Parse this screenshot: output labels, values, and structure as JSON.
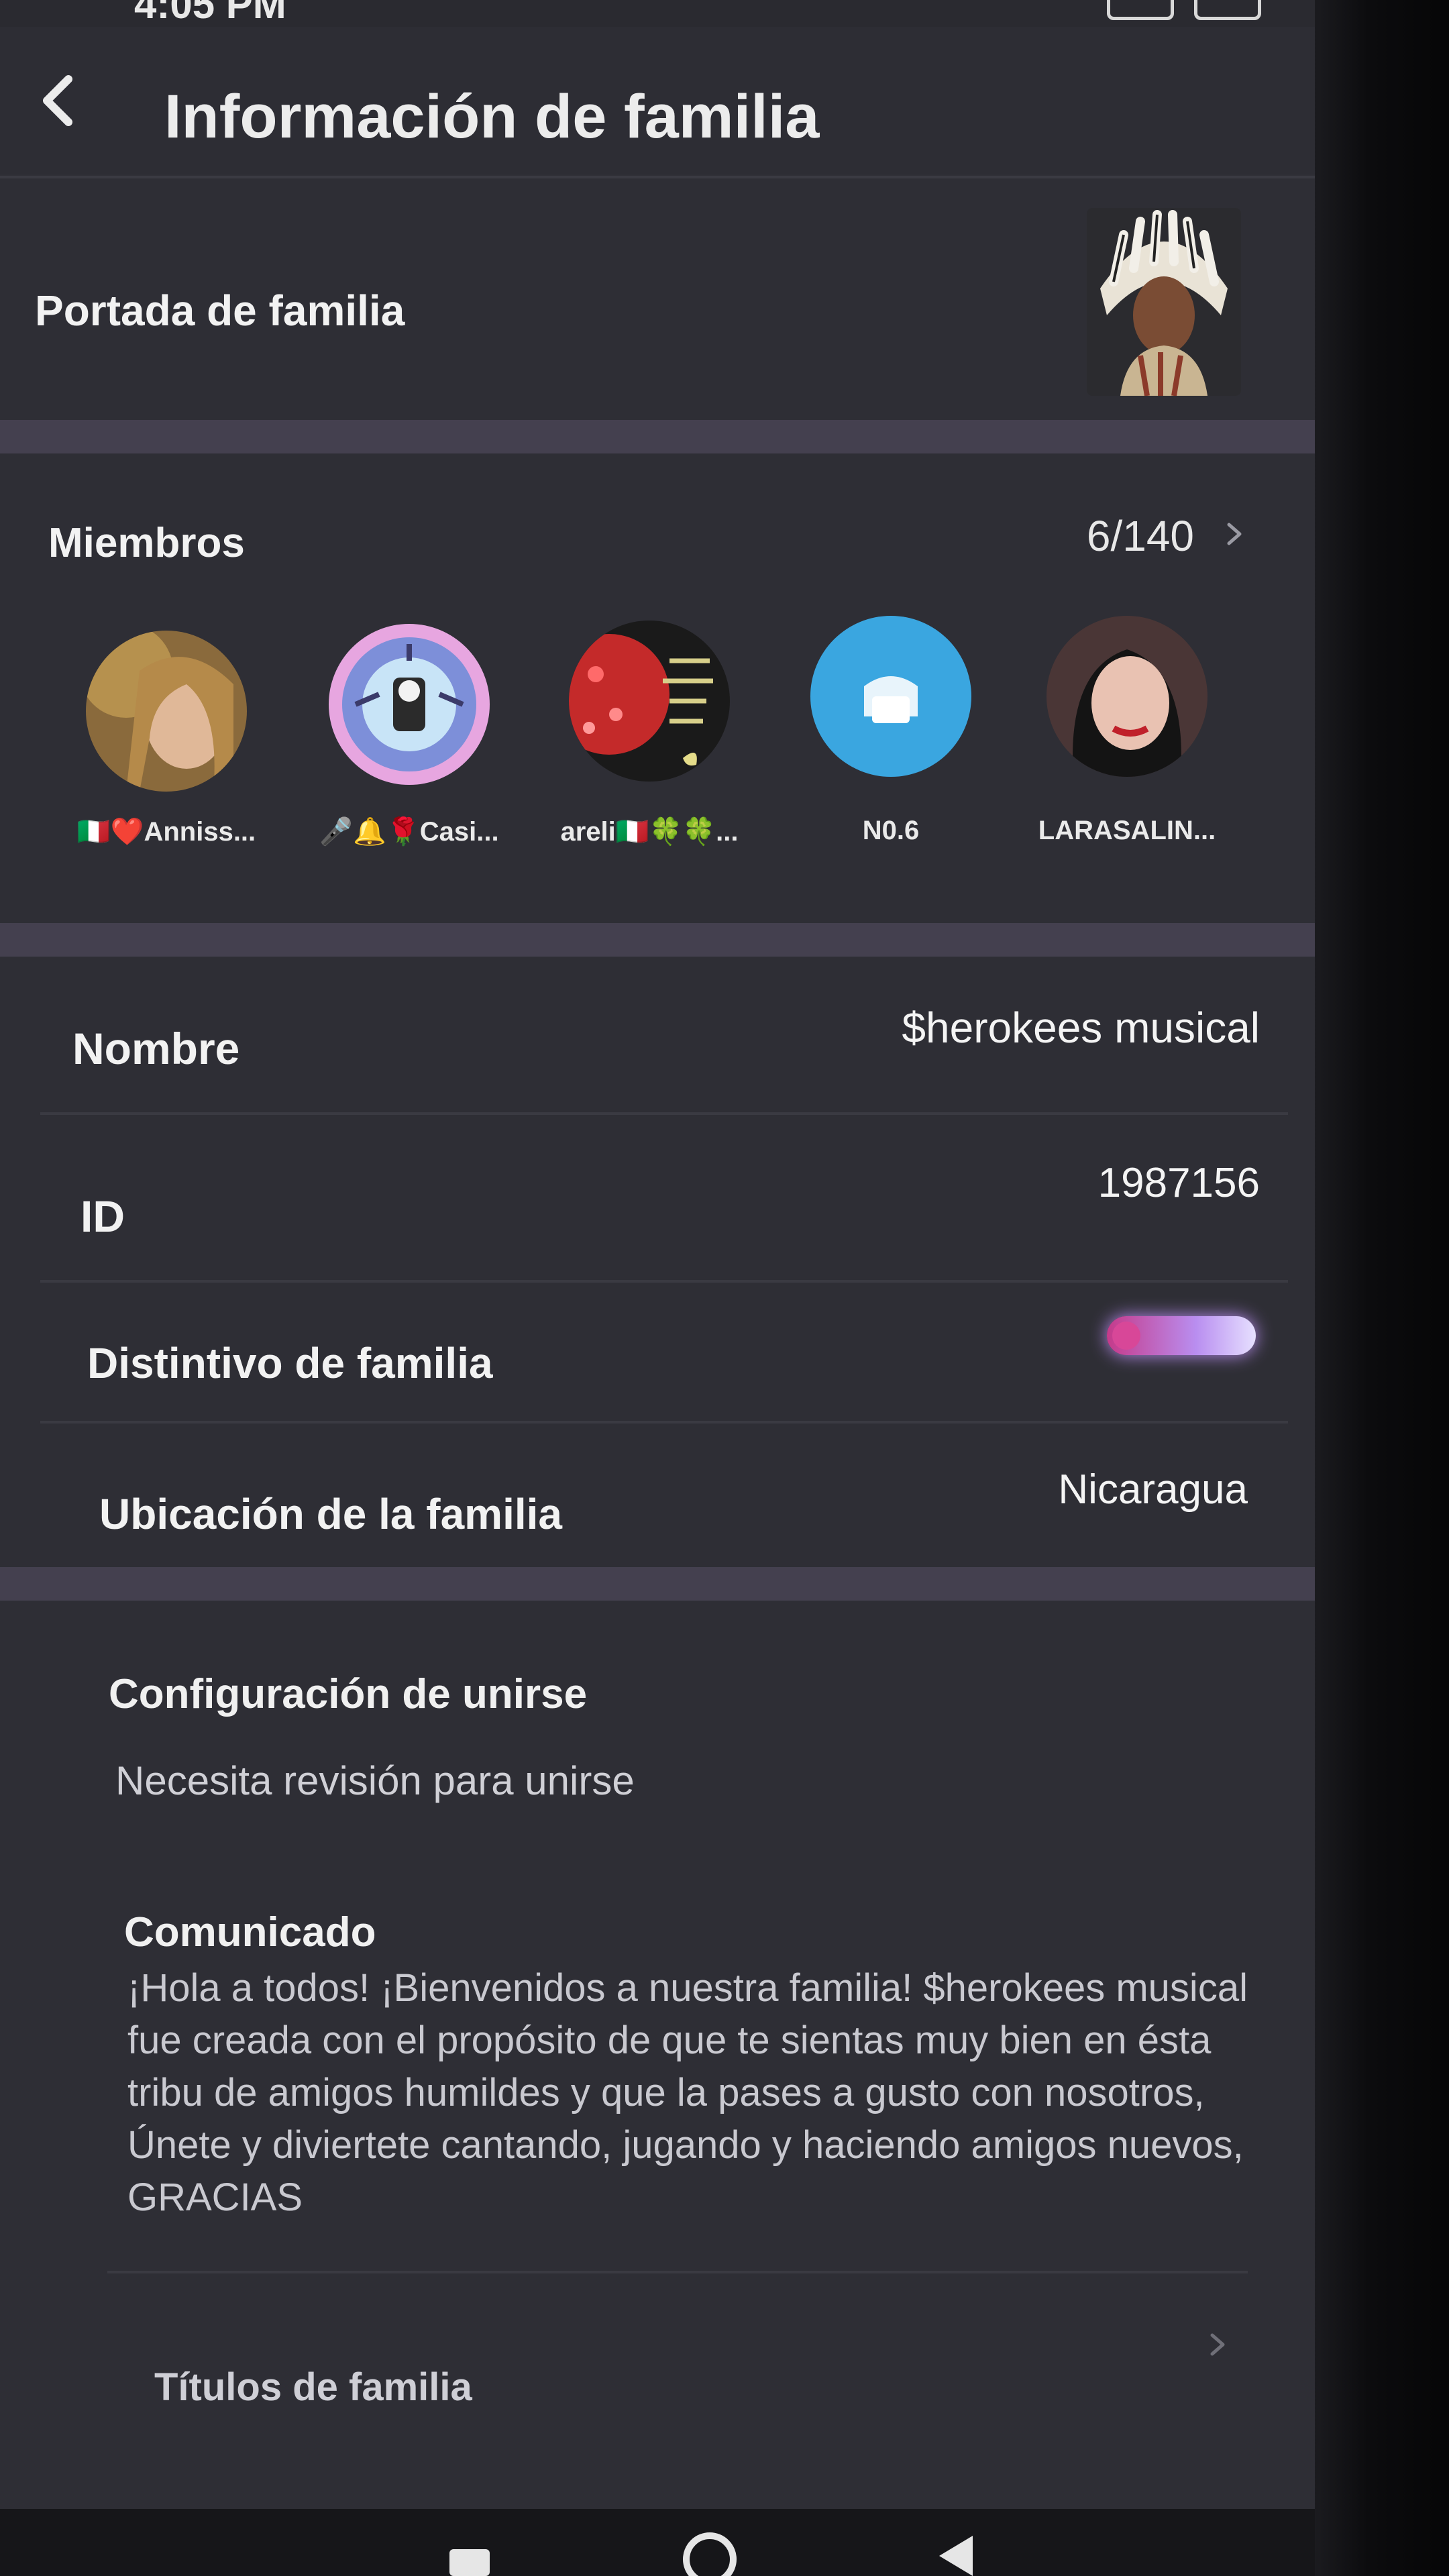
{
  "status": {
    "time": "4:05 PM"
  },
  "header": {
    "title": "Información de familia"
  },
  "cover": {
    "label": "Portada de familia"
  },
  "members": {
    "label": "Miembros",
    "count": "6/140",
    "items": [
      {
        "name": "🇮🇹❤️Anniss..."
      },
      {
        "name": "🎤🔔🌹Casi..."
      },
      {
        "name": "areli🇮🇹🍀🍀..."
      },
      {
        "name": "N0.6"
      },
      {
        "name": "LARASALIN..."
      }
    ]
  },
  "info": {
    "name_label": "Nombre",
    "name_value": "$herokees musical",
    "id_label": "ID",
    "id_value": "1987156",
    "badge_label": "Distintivo de familia",
    "location_label": "Ubicación de la familia",
    "location_value": "Nicaragua"
  },
  "join": {
    "label": "Configuración de unirse",
    "value": "Necesita revisión para unirse"
  },
  "announcement": {
    "label": "Comunicado",
    "text": "¡Hola a todos! ¡Bienvenidos a nuestra familia! $herokees musical fue creada con el propósito de que te sientas muy bien en ésta tribu de amigos humildes y que la pases a gusto con nosotros, Únete y diviertete cantando, jugando y haciendo amigos nuevos, GRACIAS"
  },
  "titles": {
    "label": "Títulos de familia"
  },
  "colors": {
    "background": "#2f2f36",
    "section_gap": "#44404f",
    "accent_blue": "#3aa6e0"
  }
}
